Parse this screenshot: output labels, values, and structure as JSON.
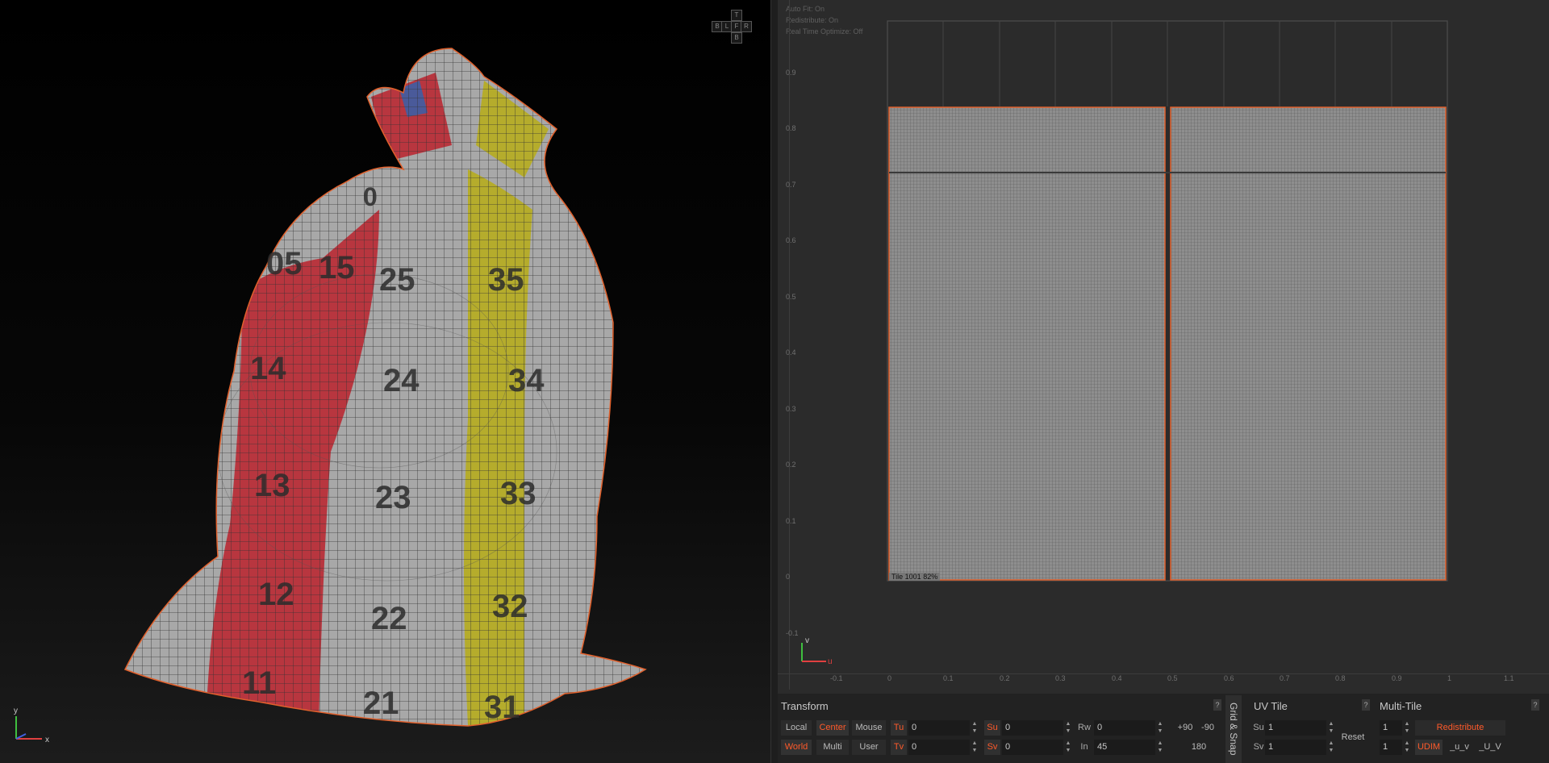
{
  "viewport_3d": {
    "nav_cube": [
      "T",
      "B",
      "L",
      "F",
      "R",
      "B"
    ],
    "axes": {
      "y": "y",
      "x": "x"
    },
    "mesh_labels": [
      "05",
      "15",
      "25",
      "35",
      "14",
      "24",
      "34",
      "13",
      "23",
      "33",
      "12",
      "22",
      "32",
      "11",
      "21",
      "31",
      "0"
    ]
  },
  "uv_overlay": {
    "auto_fit": "Auto Fit: On",
    "redistribute": "Redistribute: On",
    "realtime": "Real Time Optimize: Off"
  },
  "uv_editor": {
    "v_ticks": [
      "0.9",
      "0.8",
      "0.7",
      "0.6",
      "0.5",
      "0.4",
      "0.3",
      "0.2",
      "0.1",
      "0",
      "-0.1"
    ],
    "u_ticks": [
      "-0.1",
      "0",
      "0.1",
      "0.2",
      "0.3",
      "0.4",
      "0.5",
      "0.6",
      "0.7",
      "0.8",
      "0.9",
      "1",
      "1.1"
    ],
    "tile_label": "Tile 1001 82%",
    "axis_v": "v",
    "axis_u": "u"
  },
  "transform": {
    "title": "Transform",
    "help": "?",
    "local": "Local",
    "center": "Center",
    "mouse": "Mouse",
    "world": "World",
    "multi": "Multi",
    "user": "User",
    "tu_label": "Tu",
    "tu": "0",
    "tv_label": "Tv",
    "tv": "0",
    "su_label": "Su",
    "su": "0",
    "sv_label": "Sv",
    "sv": "0",
    "rw_label": "Rw",
    "rw": "0",
    "in_label": "In",
    "in": "45",
    "plus90": "+90",
    "minus90": "-90",
    "deg180": "180"
  },
  "grid_snap": {
    "label": "Grid & Snap"
  },
  "uv_tile": {
    "title": "UV Tile",
    "help": "?",
    "su_label": "Su",
    "su": "1",
    "sv_label": "Sv",
    "sv": "1",
    "reset": "Reset"
  },
  "multi_tile": {
    "title": "Multi-Tile",
    "help": "?",
    "v1": "1",
    "v2": "1",
    "redistribute": "Redistribute",
    "udim": "UDIM",
    "u_v": "_u_v",
    "U_V": "_U_V"
  },
  "colors": {
    "accent": "#ff5a2a",
    "red_panel": "#b8363f",
    "yellow_panel": "#b5ac2c",
    "grey_panel": "#a8a8a8"
  }
}
